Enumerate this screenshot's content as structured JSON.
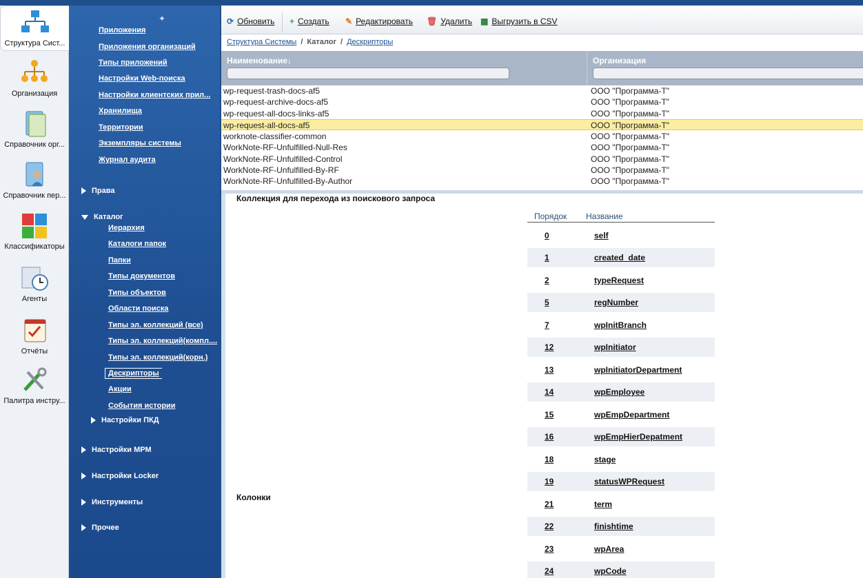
{
  "rail": {
    "items": [
      {
        "label": "Структура Сист...",
        "icon": "system-structure-icon",
        "active": true
      },
      {
        "label": "Организация",
        "icon": "org-chart-icon"
      },
      {
        "label": "Справочник орг...",
        "icon": "org-directory-icon"
      },
      {
        "label": "Справочник пер...",
        "icon": "personnel-directory-icon"
      },
      {
        "label": "Классификаторы",
        "icon": "puzzle-icon"
      },
      {
        "label": "Агенты",
        "icon": "clock-agent-icon"
      },
      {
        "label": "Отчёты",
        "icon": "reports-icon"
      },
      {
        "label": "Палитра инстру...",
        "icon": "tools-icon"
      }
    ]
  },
  "nav": {
    "top_links": [
      "Приложения",
      "Приложения организаций",
      "Типы приложений",
      "Настройки Web-поиска",
      "Настройки клиентских прил...",
      "Хранилища",
      "Территории",
      "Экземпляры системы",
      "Журнал аудита"
    ],
    "groups": {
      "rights": "Права",
      "catalog": "Каталог",
      "mpm": "Настройки МРМ",
      "locker": "Настройки Locker",
      "tools": "Инструменты",
      "other": "Прочее"
    },
    "catalog_links": [
      "Иерархия",
      "Каталоги папок",
      "Папки",
      "Типы документов",
      "Типы объектов",
      "Области поиска",
      "Типы эл. коллекций (все)",
      "Типы эл. коллекций(компл....",
      "Типы эл. коллекций(корн.)",
      "Дескрипторы",
      "Акции",
      "События истории"
    ],
    "pkd": "Настройки ПКД",
    "selected": "Дескрипторы"
  },
  "toolbar": {
    "refresh": "Обновить",
    "create": "Создать",
    "edit": "Редактировать",
    "delete": "Удалить",
    "export": "Выгрузить в CSV"
  },
  "breadcrumb": {
    "root": "Структура Системы",
    "middle": "Каталог",
    "current": "Дескрипторы"
  },
  "grid": {
    "col_name": "Наименование",
    "col_org": "Организация",
    "rows": [
      {
        "name": "wp-request-trash-docs-af5",
        "org": "ООО \"Программа-Т\""
      },
      {
        "name": "wp-request-archive-docs-af5",
        "org": "ООО \"Программа-Т\""
      },
      {
        "name": "wp-request-all-docs-links-af5",
        "org": "ООО \"Программа-Т\""
      },
      {
        "name": "wp-request-all-docs-af5",
        "org": "ООО \"Программа-Т\"",
        "selected": true
      },
      {
        "name": "worknote-classifier-common",
        "org": "ООО \"Программа-Т\""
      },
      {
        "name": "WorkNote-RF-Unfulfilled-Null-Res",
        "org": "ООО \"Программа-Т\""
      },
      {
        "name": "WorkNote-RF-Unfulfilled-Control",
        "org": "ООО \"Программа-Т\""
      },
      {
        "name": "WorkNote-RF-Unfulfilled-By-RF",
        "org": "ООО \"Программа-Т\""
      },
      {
        "name": "WorkNote-RF-Unfulfilled-By-Author",
        "org": "ООО \"Программа-Т\""
      }
    ]
  },
  "detail": {
    "collection_label": "Коллекция для перехода из поискового запроса",
    "columns_label": "Колонки",
    "head_order": "Порядок",
    "head_name": "Название",
    "columns": [
      {
        "order": "0",
        "name": "self"
      },
      {
        "order": "1",
        "name": "created_date"
      },
      {
        "order": "2",
        "name": "typeRequest"
      },
      {
        "order": "5",
        "name": "regNumber"
      },
      {
        "order": "7",
        "name": "wpInitBranch"
      },
      {
        "order": "12",
        "name": "wpInitiator"
      },
      {
        "order": "13",
        "name": "wpInitiatorDepartment"
      },
      {
        "order": "14",
        "name": "wpEmployee"
      },
      {
        "order": "15",
        "name": "wpEmpDepartment"
      },
      {
        "order": "16",
        "name": "wpEmpHierDepatment"
      },
      {
        "order": "18",
        "name": "stage"
      },
      {
        "order": "19",
        "name": "statusWPRequest"
      },
      {
        "order": "21",
        "name": "term"
      },
      {
        "order": "22",
        "name": "finishtime"
      },
      {
        "order": "23",
        "name": "wpArea"
      },
      {
        "order": "24",
        "name": "wpCode"
      }
    ]
  },
  "colors": {
    "nav_bg": "#1f4f92",
    "selected_row": "#fbeda1",
    "grid_header": "#a9b6c8"
  }
}
